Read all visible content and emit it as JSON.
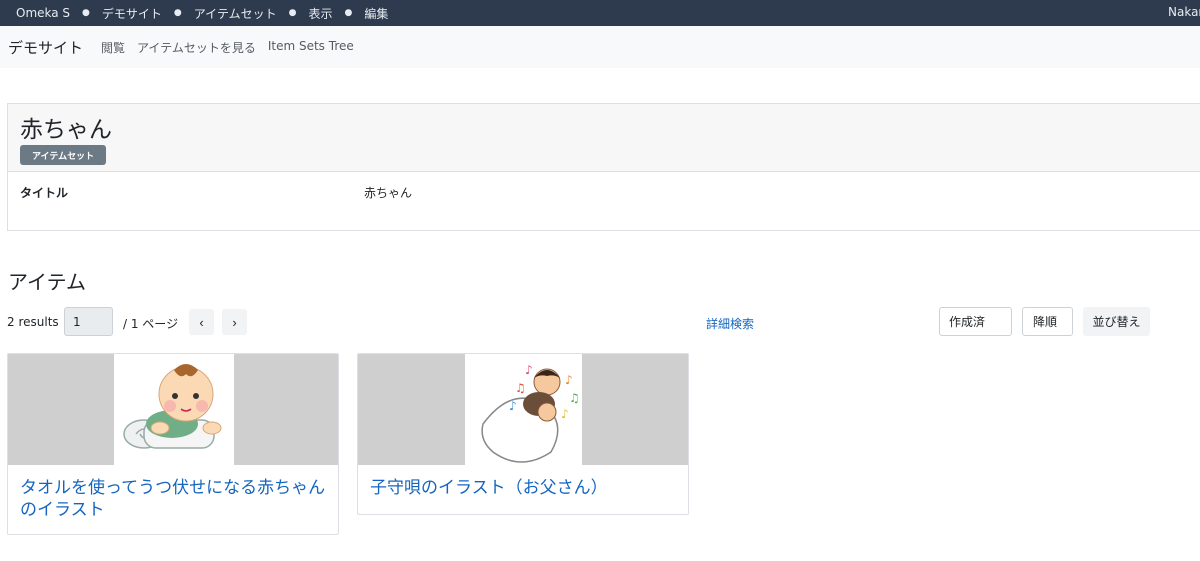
{
  "topbar": {
    "crumbs": [
      "Omeka S",
      "デモサイト",
      "アイテムセット",
      "表示",
      "編集"
    ],
    "user": "Nakamura"
  },
  "sitenav": {
    "brand": "デモサイト",
    "links": [
      "閲覧",
      "アイテムセットを見る",
      "Item Sets Tree"
    ]
  },
  "itemset": {
    "title": "赤ちゃん",
    "badge": "アイテムセット",
    "property_label": "タイトル",
    "property_value": "赤ちゃん"
  },
  "items": {
    "heading": "アイテム",
    "results": "2 results",
    "page_value": "1",
    "page_total": "/ 1 ページ",
    "prev_icon": "chevron-left-icon",
    "next_icon": "chevron-right-icon",
    "advanced_search": "詳細検索",
    "sort_by": "作成済",
    "sort_order": "降順",
    "sort_button": "並び替え",
    "cards": [
      {
        "title": "タオルを使ってうつ伏せになる赤ちゃんのイラスト"
      },
      {
        "title": "子守唄のイラスト（お父さん）"
      }
    ]
  },
  "colors": {
    "topbar_bg": "#2e3a4d",
    "link": "#1565c0",
    "badge_bg": "#6c7a86"
  }
}
